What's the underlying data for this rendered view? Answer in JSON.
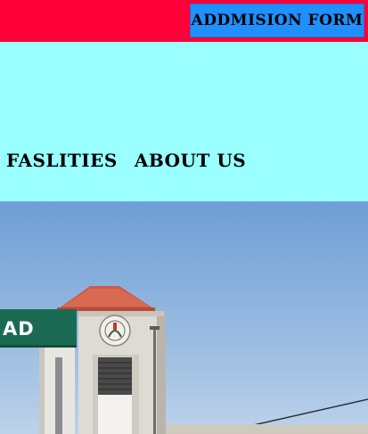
{
  "header": {
    "admission_button_label": "ADDMISION FORM"
  },
  "nav": {
    "items": [
      {
        "label": "FASLITIES"
      },
      {
        "label": "ABOUT US"
      }
    ]
  },
  "hero": {
    "sign_text": "AD"
  },
  "colors": {
    "topbar": "#ff0038",
    "button": "#1e90ff",
    "navband": "#99ffff"
  }
}
